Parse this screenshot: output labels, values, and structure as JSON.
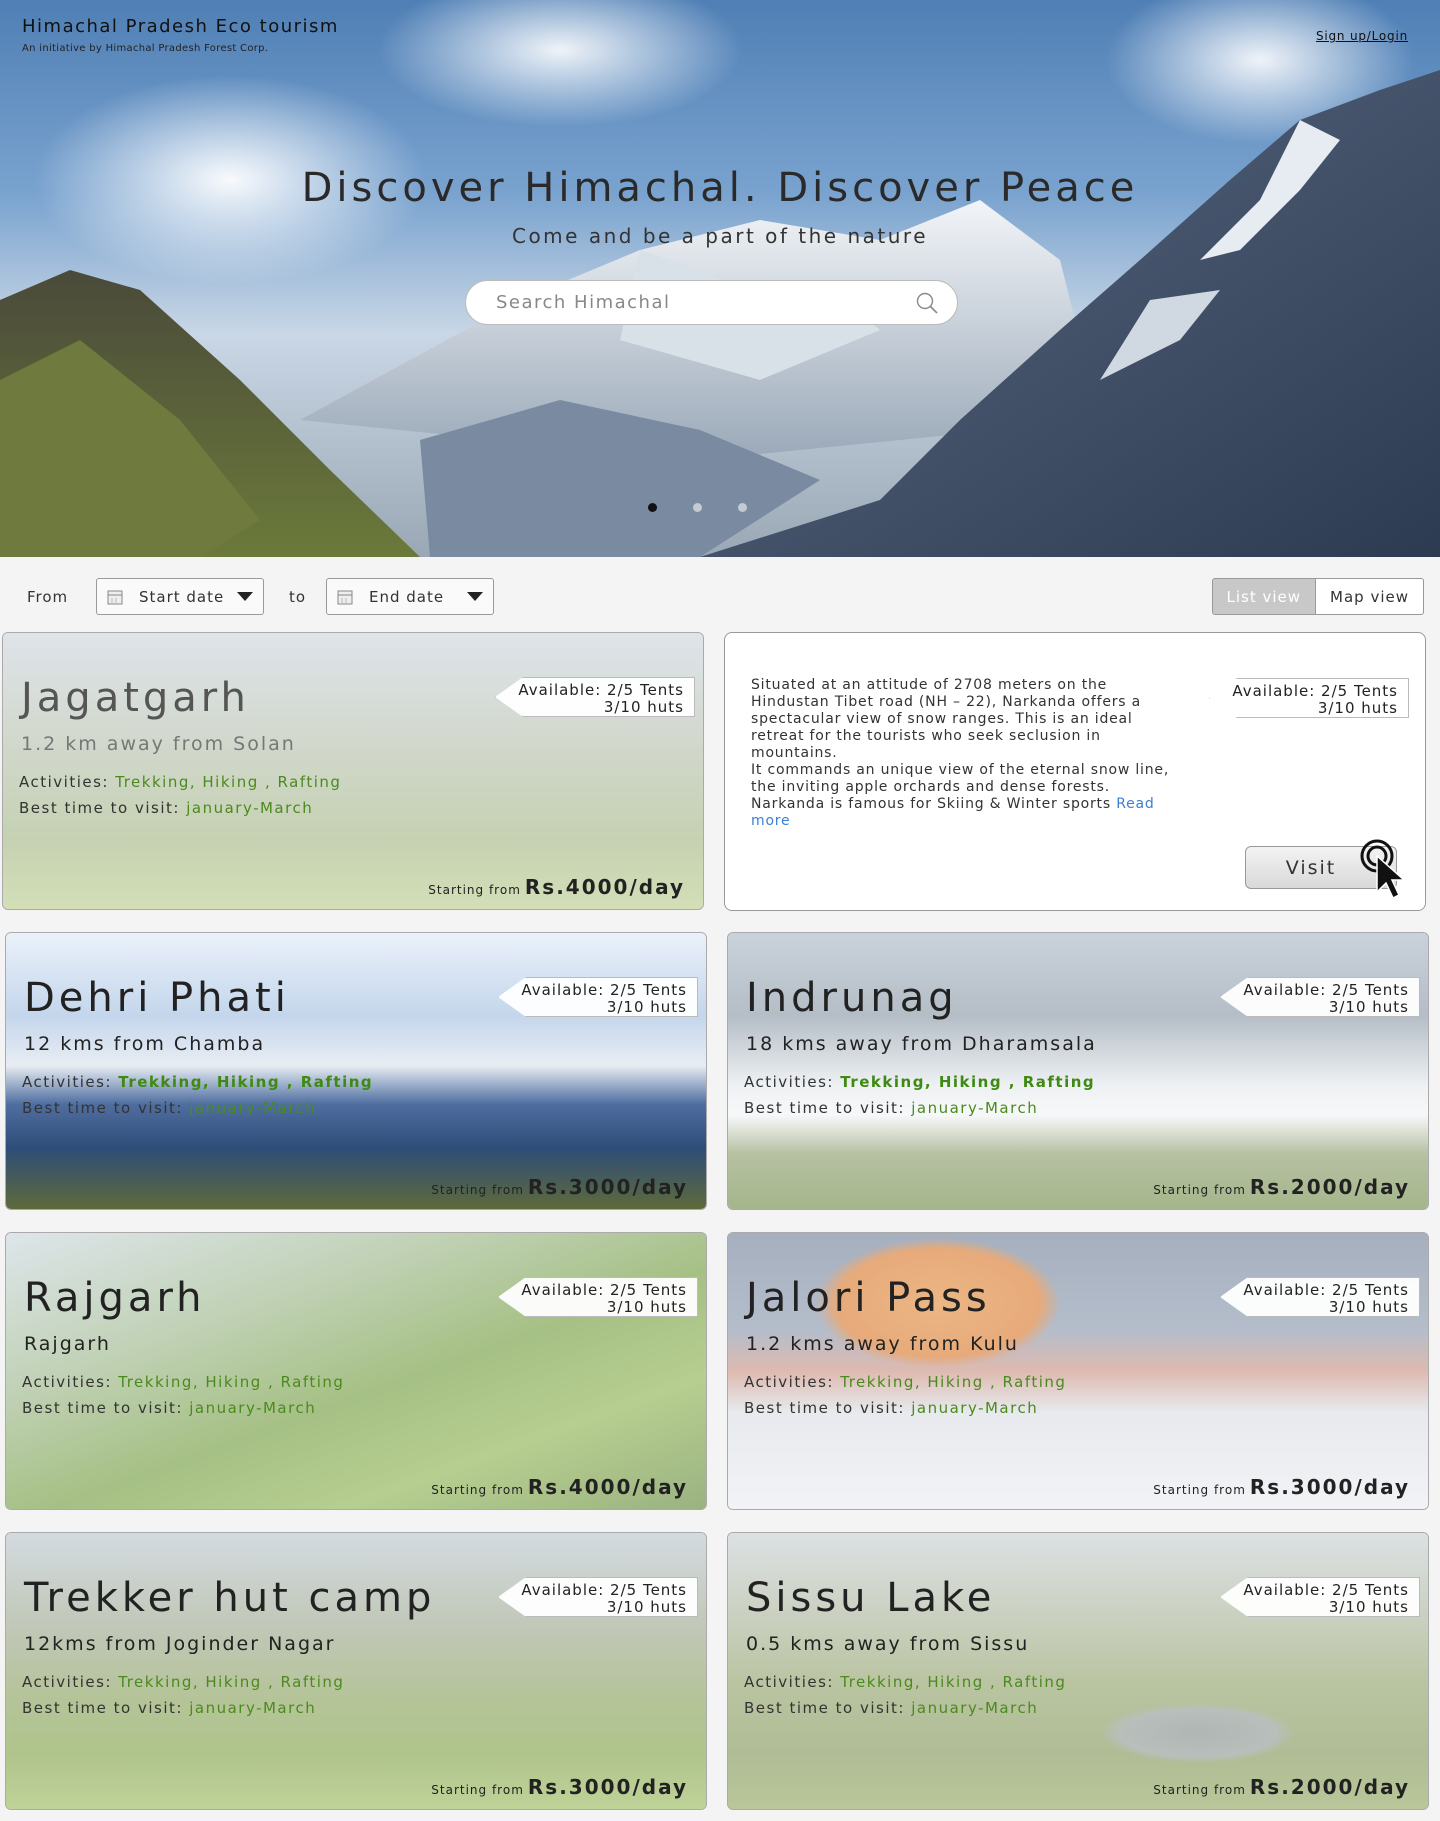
{
  "header": {
    "brand_title": "Himachal Pradesh Eco  tourism",
    "brand_subtitle": "An initiative by Himachal Pradesh Forest Corp.",
    "signin": "Sign up/Login"
  },
  "hero": {
    "title": "Discover Himachal. Discover Peace",
    "subtitle": "Come and be a part of the nature",
    "search_placeholder": "Search Himachal",
    "carousel_dots": 3,
    "active_dot": 0
  },
  "filters": {
    "from_label": "From",
    "start_date": "Start date",
    "to_label": "to",
    "end_date": "End date",
    "list_view": "List view",
    "map_view": "Map view"
  },
  "common": {
    "activities_label": "Activities:",
    "best_time_label": "Best time to visit:",
    "starting_from": "Starting from",
    "tents": "Available: 2/5 Tents",
    "huts": "3/10 huts"
  },
  "info_card": {
    "description": "Situated at an attitude of 2708 meters on the Hindustan Tibet road (NH – 22), Narkanda offers a spectacular view of snow ranges. This is an ideal retreat for the tourists who seek seclusion in mountains.",
    "description2": "It commands an unique view of the eternal snow line, the inviting apple orchards and dense forests. Narkanda is famous for Skiing & Winter sports",
    "read_more": "Read more",
    "visit": "Visit"
  },
  "cards": [
    {
      "name": "Jagatgarh",
      "distance": "1.2 km away from Solan",
      "activities": "Trekking, Hiking , Rafting",
      "best_time": "january-March",
      "price": "Rs.4000/day"
    },
    {
      "name": "Dehri Phati",
      "distance": "12 kms from Chamba",
      "activities": "Trekking, Hiking , Rafting",
      "best_time": "january-March",
      "price": "Rs.3000/day"
    },
    {
      "name": "Indrunag",
      "distance": "18 kms away from Dharamsala",
      "activities": "Trekking, Hiking , Rafting",
      "best_time": "january-March",
      "price": "Rs.2000/day"
    },
    {
      "name": "Rajgarh",
      "distance": "Rajgarh",
      "activities": "Trekking, Hiking , Rafting",
      "best_time": "january-March",
      "price": "Rs.4000/day"
    },
    {
      "name": "Jalori Pass",
      "distance": "1.2 kms away from Kulu",
      "activities": "Trekking, Hiking , Rafting",
      "best_time": "january-March",
      "price": "Rs.3000/day"
    },
    {
      "name": "Trekker hut camp",
      "distance": "12kms from Joginder Nagar",
      "activities": "Trekking, Hiking , Rafting",
      "best_time": "january-March",
      "price": "Rs.3000/day"
    },
    {
      "name": "Sissu Lake",
      "distance": "0.5 kms away from Sissu",
      "activities": "Trekking, Hiking , Rafting",
      "best_time": "january-March",
      "price": "Rs.2000/day"
    }
  ]
}
